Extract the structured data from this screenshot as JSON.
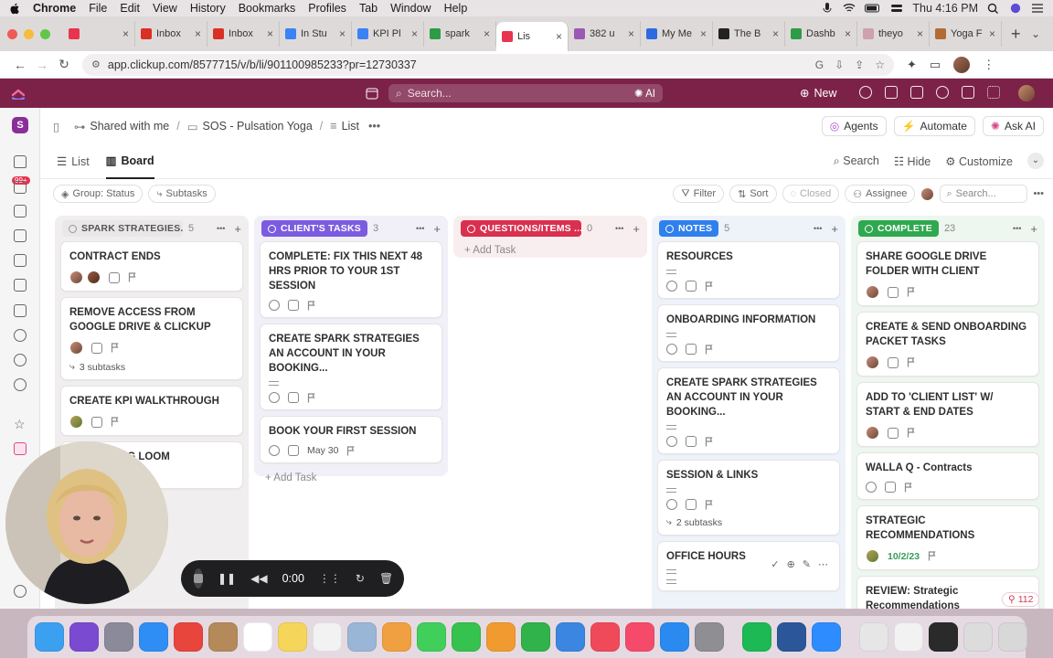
{
  "menubar": {
    "app": "Chrome",
    "items": [
      "File",
      "Edit",
      "View",
      "History",
      "Bookmarks",
      "Profiles",
      "Tab",
      "Window",
      "Help"
    ],
    "clock": "Thu 4:16 PM"
  },
  "tabs": [
    {
      "label": "",
      "color": "#e8344e"
    },
    {
      "label": "Inbox",
      "color": "#d93025"
    },
    {
      "label": "Inbox",
      "color": "#d93025"
    },
    {
      "label": "In Stu",
      "color": "#3b82f6"
    },
    {
      "label": "KPI Pl",
      "color": "#3b82f6"
    },
    {
      "label": "spark",
      "color": "#2e9b46"
    },
    {
      "label": "Lis",
      "color": "#e8344e",
      "active": true
    },
    {
      "label": "382 u",
      "color": "#9b59b6"
    },
    {
      "label": "My Me",
      "color": "#2d6ae0"
    },
    {
      "label": "The B",
      "color": "#222222"
    },
    {
      "label": "Dashb",
      "color": "#2e9b46"
    },
    {
      "label": "theyo",
      "color": "#cfa0b0"
    },
    {
      "label": "Yoga F",
      "color": "#b36b35"
    }
  ],
  "address": {
    "url": "app.clickup.com/8577715/v/b/li/901100985233?pr=12730337"
  },
  "clickup": {
    "search_placeholder": "Search...",
    "ai_label": "AI",
    "new_label": "New"
  },
  "rail": {
    "workspace_letter": "S",
    "badge": "99+"
  },
  "breadcrumb": {
    "shared": "Shared with me",
    "space": "SOS - Pulsation Yoga",
    "list": "List",
    "agents": "Agents",
    "automate": "Automate",
    "ask_ai": "Ask AI"
  },
  "views": {
    "list": "List",
    "board": "Board",
    "search": "Search",
    "hide": "Hide",
    "customize": "Customize"
  },
  "filters": {
    "group": "Group: Status",
    "subtasks": "Subtasks",
    "filter": "Filter",
    "sort": "Sort",
    "closed": "Closed",
    "assignee": "Assignee",
    "search_placeholder": "Search..."
  },
  "columns": [
    {
      "name": "SPARK STRATEGIES...",
      "count": "5",
      "color": "#f0eeee",
      "pill": "#e9e7e8",
      "pill_text": "#555555",
      "cards": [
        {
          "title": "CONTRACT ENDS"
        },
        {
          "title": "REMOVE ACCESS FROM GOOGLE DRIVE & CLICKUP",
          "subtasks": "3 subtasks"
        },
        {
          "title": "CREATE KPI WALKTHROUGH"
        },
        {
          "title": "...BOARDING LOOM"
        }
      ]
    },
    {
      "name": "CLIENT'S TASKS",
      "count": "3",
      "color": "#f1eff7",
      "pill": "#7b5ce0",
      "cards": [
        {
          "title": "COMPLETE: FIX THIS NEXT 48 HRS PRIOR TO YOUR 1ST SESSION"
        },
        {
          "title": "CREATE SPARK STRATEGIES AN ACCOUNT IN YOUR BOOKING..."
        },
        {
          "title": "BOOK YOUR FIRST SESSION",
          "date": "May 30"
        }
      ],
      "add": "Add Task"
    },
    {
      "name": "QUESTIONS/ITEMS ...",
      "count": "0",
      "color": "#f9eeef",
      "pill": "#d9304f",
      "add": "Add Task"
    },
    {
      "name": "NOTES",
      "count": "5",
      "color": "#eef2f9",
      "pill": "#2f80ed",
      "cards": [
        {
          "title": "RESOURCES"
        },
        {
          "title": "ONBOARDING INFORMATION"
        },
        {
          "title": "CREATE SPARK STRATEGIES AN ACCOUNT IN YOUR BOOKING..."
        },
        {
          "title": "SESSION & LINKS",
          "subtasks": "2 subtasks"
        },
        {
          "title": "OFFICE HOURS"
        }
      ]
    },
    {
      "name": "COMPLETE",
      "count": "23",
      "color": "#eef6f0",
      "pill": "#2fa84f",
      "cards": [
        {
          "title": "SHARE GOOGLE DRIVE FOLDER WITH CLIENT"
        },
        {
          "title": "CREATE & SEND ONBOARDING PACKET TASKS"
        },
        {
          "title": "ADD TO 'CLIENT LIST' W/ START & END DATES"
        },
        {
          "title": "WALLA Q - Contracts"
        },
        {
          "title": "STRATEGIC RECOMMENDATIONS",
          "date": "10/2/23"
        },
        {
          "title": "REVIEW: Strategic Recommendations"
        }
      ]
    }
  ],
  "recorder": {
    "time": "0:00"
  },
  "counter": "112"
}
